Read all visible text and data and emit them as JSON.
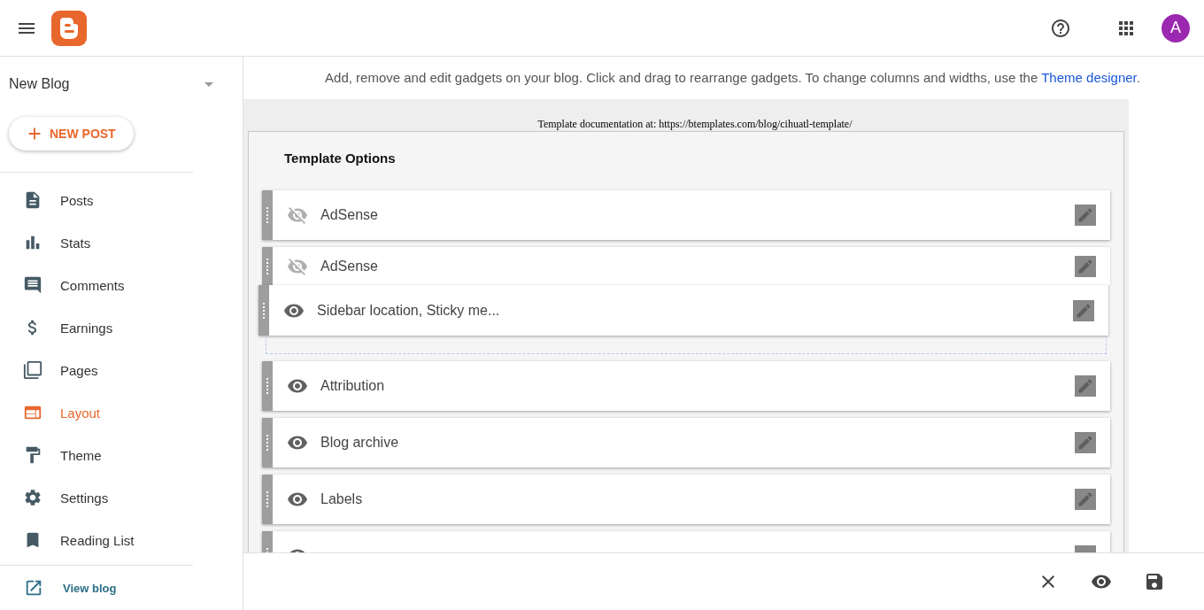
{
  "header": {
    "avatar": "A"
  },
  "sidebar": {
    "blog_name": "New Blog",
    "new_post": "NEW POST",
    "items": [
      {
        "label": "Posts",
        "selected": false
      },
      {
        "label": "Stats",
        "selected": false
      },
      {
        "label": "Comments",
        "selected": false
      },
      {
        "label": "Earnings",
        "selected": false
      },
      {
        "label": "Pages",
        "selected": false
      },
      {
        "label": "Layout",
        "selected": true
      },
      {
        "label": "Theme",
        "selected": false
      },
      {
        "label": "Settings",
        "selected": false
      },
      {
        "label": "Reading List",
        "selected": false
      }
    ],
    "view_blog": "View blog"
  },
  "intro": {
    "text": "Add, remove and edit gadgets on your blog. Click and drag to rearrange gadgets. To change columns and widths, use the ",
    "link": "Theme designer",
    "end": "."
  },
  "template_note": "Template documentation at: https://btemplates.com/blog/cihuatl-template/",
  "section": {
    "title": "Template Options",
    "gadgets": [
      {
        "kind": "gadget",
        "title": "AdSense",
        "visible": false
      },
      {
        "kind": "covered",
        "title": "AdSense",
        "visible": false
      },
      {
        "kind": "dragged",
        "title": "Sidebar location, Sticky me...",
        "visible": true
      },
      {
        "kind": "placeholder"
      },
      {
        "kind": "gadget",
        "title": "Attribution",
        "visible": true
      },
      {
        "kind": "gadget",
        "title": "Blog archive",
        "visible": true
      },
      {
        "kind": "gadget",
        "title": "Labels",
        "visible": true
      },
      {
        "kind": "partial",
        "visible": true
      }
    ]
  }
}
